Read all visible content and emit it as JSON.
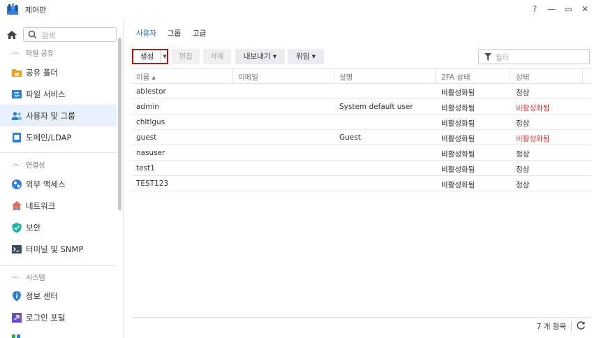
{
  "window": {
    "title": "제어판",
    "help_label": "?",
    "minimize_label": "—",
    "maximize_label": "▭",
    "close_label": "✕"
  },
  "sidebar": {
    "search_placeholder": "검색",
    "sections": [
      {
        "label": "파일 공유",
        "items": [
          {
            "label": "공유 폴더",
            "icon": "folder-share-icon",
            "active": false
          },
          {
            "label": "파일 서비스",
            "icon": "file-services-icon",
            "active": false
          },
          {
            "label": "사용자 및 그룹",
            "icon": "users-groups-icon",
            "active": true
          },
          {
            "label": "도메인/LDAP",
            "icon": "domain-ldap-icon",
            "active": false
          }
        ]
      },
      {
        "label": "연결성",
        "items": [
          {
            "label": "외부 액세스",
            "icon": "external-access-icon",
            "active": false
          },
          {
            "label": "네트워크",
            "icon": "network-icon",
            "active": false
          },
          {
            "label": "보안",
            "icon": "shield-icon",
            "active": false
          },
          {
            "label": "터미널 및 SNMP",
            "icon": "terminal-icon",
            "active": false
          }
        ]
      },
      {
        "label": "시스템",
        "items": [
          {
            "label": "정보 센터",
            "icon": "info-center-icon",
            "active": false
          },
          {
            "label": "로그인 포털",
            "icon": "login-portal-icon",
            "active": false
          }
        ]
      }
    ]
  },
  "tabs": [
    {
      "label": "사용자",
      "active": true
    },
    {
      "label": "그룹",
      "active": false
    },
    {
      "label": "고급",
      "active": false
    }
  ],
  "toolbar": {
    "create_label": "생성",
    "edit_label": "편집",
    "delete_label": "삭제",
    "export_label": "내보내기 ▾",
    "delegate_label": "위임 ▾",
    "filter_placeholder": "필터"
  },
  "table": {
    "columns": [
      "이름 ▴",
      "이메일",
      "설명",
      "2FA 상태",
      "상태"
    ],
    "rows": [
      {
        "name": "ablestor",
        "email": "",
        "description": "",
        "twofa": "비활성화됨",
        "status": "정상",
        "status_alert": false
      },
      {
        "name": "admin",
        "email": "",
        "description": "System default user",
        "twofa": "비활성화됨",
        "status": "비활성화됨",
        "status_alert": true
      },
      {
        "name": "chltlgus",
        "email": "",
        "description": "",
        "twofa": "비활성화됨",
        "status": "정상",
        "status_alert": false
      },
      {
        "name": "guest",
        "email": "",
        "description": "Guest",
        "twofa": "비활성화됨",
        "status": "비활성화됨",
        "status_alert": true
      },
      {
        "name": "nasuser",
        "email": "",
        "description": "",
        "twofa": "비활성화됨",
        "status": "정상",
        "status_alert": false
      },
      {
        "name": "test1",
        "email": "",
        "description": "",
        "twofa": "비활성화됨",
        "status": "정상",
        "status_alert": false
      },
      {
        "name": "TEST123",
        "email": "",
        "description": "",
        "twofa": "비활성화됨",
        "status": "정상",
        "status_alert": false
      }
    ],
    "footer_count": "7 개 항목"
  },
  "colors": {
    "accent": "#2c6fb8",
    "alert": "#d83a3a",
    "active_bg": "#e8f1fb",
    "highlight_border": "#e00000"
  }
}
